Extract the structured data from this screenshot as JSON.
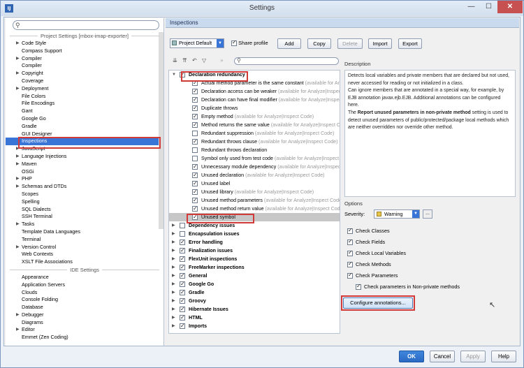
{
  "window": {
    "title": "Settings",
    "app_icon": "IJ"
  },
  "left": {
    "search_placeholder": "",
    "project_header": "Project Settings [mbox-imap-exporter]",
    "project_items": [
      {
        "label": "Code Style",
        "arrow": "▶"
      },
      {
        "label": "Compass Support",
        "arrow": ""
      },
      {
        "label": "Compiler",
        "arrow": "▶"
      },
      {
        "label": "Compiler",
        "arrow": ""
      },
      {
        "label": "Copyright",
        "arrow": "▶"
      },
      {
        "label": "Coverage",
        "arrow": ""
      },
      {
        "label": "Deployment",
        "arrow": "▶"
      },
      {
        "label": "File Colors",
        "arrow": ""
      },
      {
        "label": "File Encodings",
        "arrow": ""
      },
      {
        "label": "Gant",
        "arrow": ""
      },
      {
        "label": "Google Go",
        "arrow": ""
      },
      {
        "label": "Gradle",
        "arrow": ""
      },
      {
        "label": "GUI Designer",
        "arrow": ""
      },
      {
        "label": "Inspections",
        "arrow": ""
      },
      {
        "label": "JavaScript",
        "arrow": "▶"
      },
      {
        "label": "Language Injections",
        "arrow": "▶"
      },
      {
        "label": "Maven",
        "arrow": "▶"
      },
      {
        "label": "OSGi",
        "arrow": ""
      },
      {
        "label": "PHP",
        "arrow": "▶"
      },
      {
        "label": "Schemas and DTDs",
        "arrow": "▶"
      },
      {
        "label": "Scopes",
        "arrow": ""
      },
      {
        "label": "Spelling",
        "arrow": ""
      },
      {
        "label": "SQL Dialects",
        "arrow": ""
      },
      {
        "label": "SSH Terminal",
        "arrow": ""
      },
      {
        "label": "Tasks",
        "arrow": "▶"
      },
      {
        "label": "Template Data Languages",
        "arrow": ""
      },
      {
        "label": "Terminal",
        "arrow": ""
      },
      {
        "label": "Version Control",
        "arrow": "▶"
      },
      {
        "label": "Web Contexts",
        "arrow": ""
      },
      {
        "label": "XSLT File Associations",
        "arrow": ""
      }
    ],
    "ide_header": "IDE Settings",
    "ide_items": [
      {
        "label": "Appearance",
        "arrow": ""
      },
      {
        "label": "Application Servers",
        "arrow": ""
      },
      {
        "label": "Clouds",
        "arrow": ""
      },
      {
        "label": "Console Folding",
        "arrow": ""
      },
      {
        "label": "Database",
        "arrow": ""
      },
      {
        "label": "Debugger",
        "arrow": "▶"
      },
      {
        "label": "Diagrams",
        "arrow": ""
      },
      {
        "label": "Editor",
        "arrow": "▶"
      },
      {
        "label": "Emmet (Zen Coding)",
        "arrow": ""
      }
    ]
  },
  "panel": {
    "title": "Inspections",
    "profile": "Project Default",
    "share_profile": "Share profile",
    "buttons": {
      "add": "Add",
      "copy": "Copy",
      "delete": "Delete",
      "import": "Import",
      "export": "Export"
    },
    "filter_placeholder": ""
  },
  "inspections": [
    {
      "label": "Declaration redundancy",
      "hint": "",
      "bold": true,
      "checked": true,
      "arrow": "▼",
      "level": 0
    },
    {
      "label": "Actual method parameter is the same constant",
      "hint": " (available for Analyze|Inspect Code)",
      "checked": true,
      "level": 1
    },
    {
      "label": "Declaration access can be weaker",
      "hint": " (available for Analyze|Inspect Code)",
      "checked": true,
      "level": 1
    },
    {
      "label": "Declaration can have final modifier",
      "hint": " (available for Analyze|Inspect Code)",
      "checked": true,
      "level": 1
    },
    {
      "label": "Duplicate throws",
      "hint": "",
      "checked": true,
      "level": 1
    },
    {
      "label": "Empty method",
      "hint": " (available for Analyze|Inspect Code)",
      "checked": true,
      "level": 1
    },
    {
      "label": "Method returns the same value",
      "hint": " (available for Analyze|Inspect Code)",
      "checked": true,
      "level": 1
    },
    {
      "label": "Redundant suppression",
      "hint": " (available for Analyze|Inspect Code)",
      "checked": false,
      "level": 1
    },
    {
      "label": "Redundant throws clause",
      "hint": " (available for Analyze|Inspect Code)",
      "checked": true,
      "level": 1
    },
    {
      "label": "Redundant throws declaration",
      "hint": "",
      "checked": false,
      "level": 1
    },
    {
      "label": "Symbol only used from test code",
      "hint": " (available for Analyze|Inspect Code)",
      "checked": false,
      "level": 1
    },
    {
      "label": "Unnecessary module dependency",
      "hint": " (available for Analyze|Inspect Code)",
      "checked": true,
      "level": 1
    },
    {
      "label": "Unused declaration",
      "hint": " (available for Analyze|Inspect Code)",
      "checked": true,
      "level": 1
    },
    {
      "label": "Unused label",
      "hint": "",
      "checked": true,
      "level": 1
    },
    {
      "label": "Unused library",
      "hint": " (available for Analyze|Inspect Code)",
      "checked": true,
      "level": 1
    },
    {
      "label": "Unused method parameters",
      "hint": " (available for Analyze|Inspect Code)",
      "checked": true,
      "level": 1
    },
    {
      "label": "Unused method return value",
      "hint": " (available for Analyze|Inspect Code)",
      "checked": true,
      "level": 1
    },
    {
      "label": "Unused symbol",
      "hint": "",
      "checked": true,
      "level": 1,
      "highlight": true
    },
    {
      "label": "Dependency issues",
      "hint": "",
      "bold": true,
      "checked": false,
      "arrow": "▶",
      "level": 0
    },
    {
      "label": "Encapsulation issues",
      "hint": "",
      "bold": true,
      "checked": false,
      "arrow": "▶",
      "level": 0
    },
    {
      "label": "Error handling",
      "hint": "",
      "bold": true,
      "checked": true,
      "arrow": "▶",
      "level": 0
    },
    {
      "label": "Finalization issues",
      "hint": "",
      "bold": true,
      "checked": true,
      "arrow": "▶",
      "level": 0
    },
    {
      "label": "FlexUnit inspections",
      "hint": "",
      "bold": true,
      "checked": true,
      "arrow": "▶",
      "level": 0
    },
    {
      "label": "FreeMarker inspections",
      "hint": "",
      "bold": true,
      "checked": true,
      "arrow": "▶",
      "level": 0
    },
    {
      "label": "General",
      "hint": "",
      "bold": true,
      "checked": true,
      "arrow": "▶",
      "level": 0
    },
    {
      "label": "Google Go",
      "hint": "",
      "bold": true,
      "checked": true,
      "arrow": "▶",
      "level": 0
    },
    {
      "label": "Gradle",
      "hint": "",
      "bold": true,
      "checked": true,
      "arrow": "▶",
      "level": 0
    },
    {
      "label": "Groovy",
      "hint": "",
      "bold": true,
      "checked": true,
      "arrow": "▶",
      "level": 0
    },
    {
      "label": "Hibernate Issues",
      "hint": "",
      "bold": true,
      "checked": true,
      "arrow": "▶",
      "level": 0
    },
    {
      "label": "HTML",
      "hint": "",
      "bold": true,
      "checked": true,
      "arrow": "▶",
      "level": 0
    },
    {
      "label": "Imports",
      "hint": "",
      "bold": true,
      "checked": true,
      "arrow": "▶",
      "level": 0
    }
  ],
  "description": {
    "label": "Description",
    "p1": "Detects local variables and private members that are declared but not used, never accessed for reading or not initialized in a class.",
    "p2": "Can ignore members that are annotated in a special way, for example, by EJB annotation javax.ejb.EJB. Additional annotations can be configured here.",
    "p3_pre": "The ",
    "p3_bold": "Report unused parameters in non-private method",
    "p3_post": " setting is used to detect unused parameters of public/protected/package local methods which are neither overridden nor override other method."
  },
  "options": {
    "label": "Options",
    "severity_label": "Severity:",
    "severity": "Warning",
    "severity_color": "#e6c54a",
    "more": "...",
    "check_classes": "Check Classes",
    "check_fields": "Check Fields",
    "check_local_vars": "Check Local Variables",
    "check_methods": "Check Methods",
    "check_parameters": "Check Parameters",
    "check_params_nonprivate": "Check parameters in Non-private methods",
    "configure_annotations": "Configure annotations..."
  },
  "footer": {
    "ok": "OK",
    "cancel": "Cancel",
    "apply": "Apply",
    "help": "Help"
  },
  "accent": "#3875d7",
  "highlight_color": "#d23a3a"
}
